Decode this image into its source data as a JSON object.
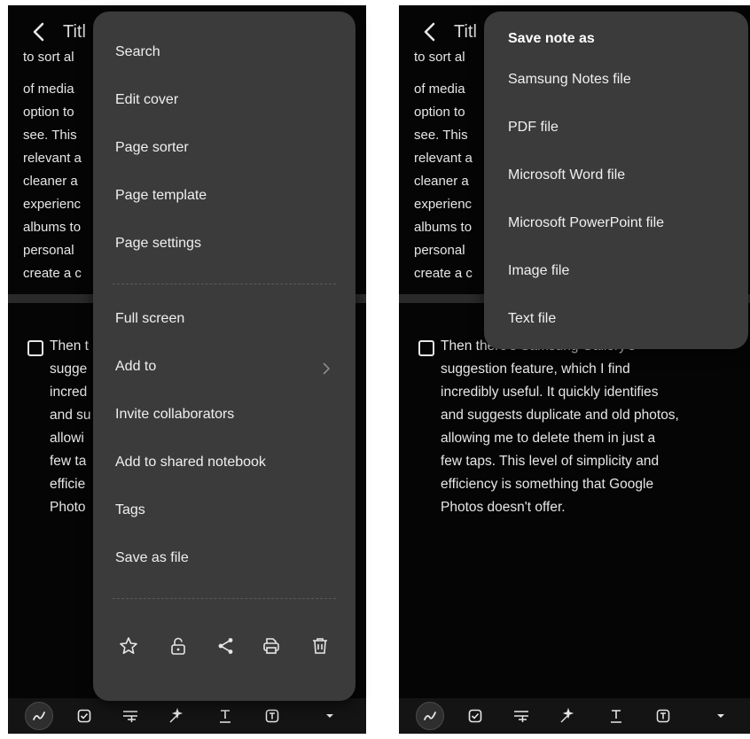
{
  "note": {
    "title": "Titl",
    "background_lines": [
      "to sort al",
      "of media",
      "option to",
      "see. This",
      "relevant a",
      "cleaner a",
      "experienc",
      "albums to",
      "personal",
      "create a c"
    ],
    "checklist_left": [
      "Then t",
      "sugge",
      "incred",
      "and su",
      "allowi",
      "few ta",
      "efficie",
      "Photo"
    ],
    "checklist_right": [
      "Then there's Samsung Gallery's",
      "suggestion feature, which I find",
      "incredibly useful. It quickly identifies",
      "and suggests duplicate and old photos,",
      "allowing me to delete them in just a",
      "few taps. This level of simplicity and",
      "efficiency is something that Google",
      "Photos doesn't offer."
    ]
  },
  "menu": {
    "items_top": [
      "Search",
      "Edit cover",
      "Page sorter",
      "Page template",
      "Page settings"
    ],
    "items_bottom": [
      "Full screen",
      "Add to",
      "Invite collaborators",
      "Add to shared notebook",
      "Tags",
      "Save as file"
    ],
    "action_icons": [
      "star-icon",
      "unlock-icon",
      "share-icon",
      "print-icon",
      "trash-icon"
    ]
  },
  "save_as": {
    "title": "Save note as",
    "options": [
      "Samsung Notes file",
      "PDF file",
      "Microsoft Word file",
      "Microsoft PowerPoint file",
      "Image file",
      "Text file"
    ]
  },
  "toolbar": {
    "icons": [
      "pen-icon",
      "checkbox-icon",
      "text-format-icon",
      "ai-sparkle-icon",
      "text-style-icon",
      "text-box-icon",
      "dropdown-arrow-icon"
    ]
  },
  "colors": {
    "background": "#050505",
    "popup": "#3b3b3b",
    "text": "#e6e6e6"
  }
}
